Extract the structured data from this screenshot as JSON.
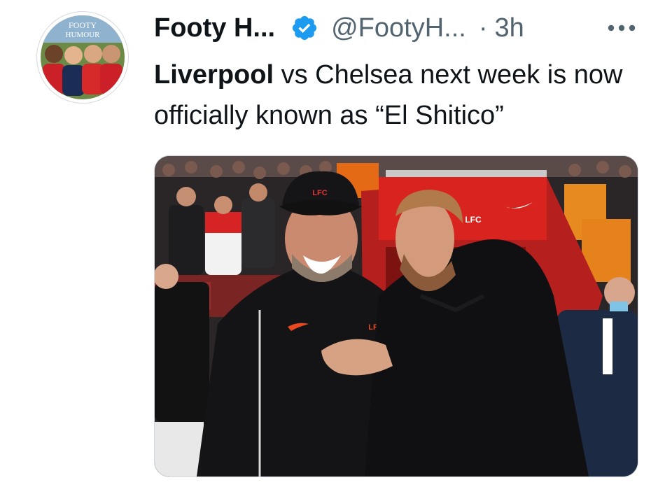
{
  "tweet": {
    "author_name": "Footy H...",
    "handle": "@FootyH...",
    "separator": "·",
    "time": "3h",
    "more_label": "•••",
    "text_bold": "Liverpool",
    "text_rest": " vs Chelsea next week is now officially known as “El Shitico”"
  },
  "avatar": {
    "label_top": "FOOTY",
    "label_bottom": "HUMOUR"
  },
  "photo": {
    "badge_text": "LFC",
    "crest_text": "LFC"
  },
  "colors": {
    "verified": "#1d9bf0",
    "text": "#0f1419",
    "secondary": "#536471",
    "tunnel_red": "#d8231e"
  },
  "icons": {
    "verified": "verified-badge-icon",
    "more": "more-icon"
  }
}
